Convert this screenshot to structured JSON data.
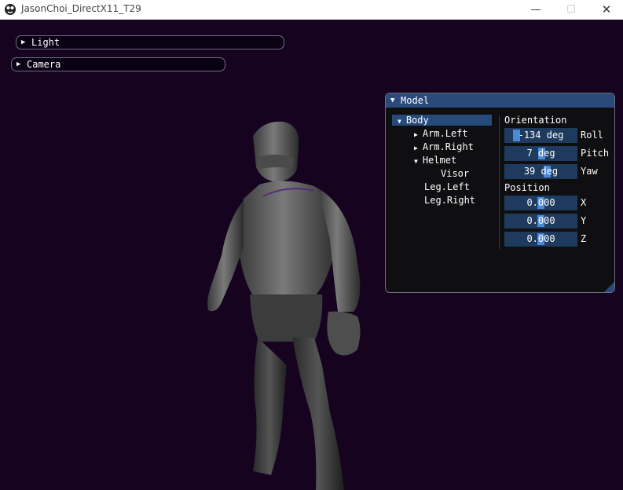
{
  "window": {
    "title": "JasonChoi_DirectX11_T29",
    "controls": {
      "minimize": "—",
      "maximize": "☐",
      "close": "✕"
    }
  },
  "panels": {
    "light": {
      "label": "Light",
      "expanded": false
    },
    "camera": {
      "label": "Camera",
      "expanded": false
    }
  },
  "model_window": {
    "title": "Model",
    "tree": {
      "body": "Body",
      "arm_left": "Arm.Left",
      "arm_right": "Arm.Right",
      "helmet": "Helmet",
      "visor": "Visor",
      "leg_left": "Leg.Left",
      "leg_right": "Leg.Right",
      "selected": "Body"
    },
    "orientation": {
      "header": "Orientation",
      "roll": {
        "value": "-134 deg",
        "axis": "Roll",
        "slider_fraction": 0.13
      },
      "pitch": {
        "value": "7 deg",
        "axis": "Pitch",
        "slider_fraction": 0.51
      },
      "yaw": {
        "value": "39 deg",
        "axis": "Yaw",
        "slider_fraction": 0.6
      }
    },
    "position": {
      "header": "Position",
      "x": {
        "value": "0.000",
        "axis": "X",
        "slider_fraction": 0.5
      },
      "y": {
        "value": "0.000",
        "axis": "Y",
        "slider_fraction": 0.5
      },
      "z": {
        "value": "0.000",
        "axis": "Z",
        "slider_fraction": 0.5
      }
    }
  },
  "colors": {
    "background": "#150320",
    "accent": "#294a7a",
    "slider_grab": "#4a8ad8",
    "frame": "#1e3b5e"
  }
}
